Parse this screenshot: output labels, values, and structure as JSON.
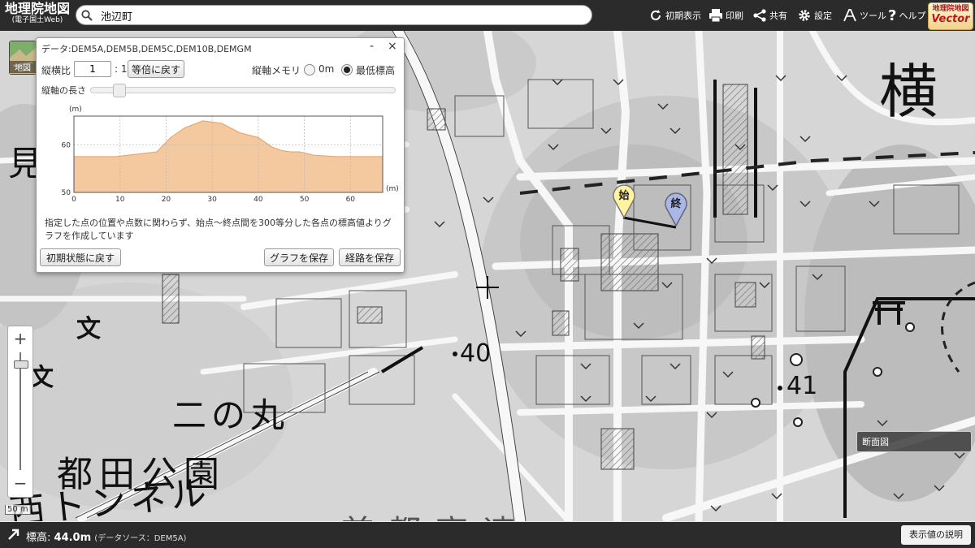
{
  "header": {
    "logo_line1": "地理院地図",
    "logo_line2": "(電子国土Web)",
    "search_value": "池辺町",
    "buttons": {
      "initial_view": "初期表示",
      "print": "印刷",
      "share": "共有",
      "settings": "設定",
      "tools": "ツール",
      "help": "ヘルプ"
    },
    "vector_badge_top": "地理院地図",
    "vector_badge_bottom": "Vector"
  },
  "layer_button": {
    "label": "地図"
  },
  "zoom": {
    "plus": "+",
    "minus": "−",
    "scale": "50 m",
    "level_fraction": 0.93
  },
  "dialog": {
    "title": "データ:DEM5A,DEM5B,DEM5C,DEM10B,DEMGM",
    "minimize": "-",
    "close": "×",
    "aspect_label": "縦横比",
    "aspect_value": "1",
    "aspect_suffix": ": 1",
    "reset_scale_button": "等倍に戻す",
    "vertical_memory_label": "縦軸メモリ",
    "radio_0m": "0m",
    "radio_min": "最低標高",
    "selected_radio": "最低標高",
    "axis_length_label": "縦軸の長さ",
    "note": "指定した点の位置や点数に関わらず、始点～終点間を300等分した各点の標高値よりグラフを作成しています",
    "buttons": {
      "reset": "初期状態に戻す",
      "save_graph": "グラフを保存",
      "save_route": "経路を保存"
    }
  },
  "chart_data": {
    "type": "area",
    "ylabel": "(m)",
    "xlabel": "(m)",
    "xlim": [
      0,
      67
    ],
    "ylim": [
      50,
      66
    ],
    "xticks": [
      0,
      10,
      20,
      30,
      40,
      50,
      60
    ],
    "yticks": [
      50,
      60
    ],
    "fill_color": "#f5c9a0",
    "line_color": "#e8a56a",
    "x": [
      0,
      9,
      18,
      21,
      24,
      28,
      32,
      36,
      40,
      43,
      45,
      47,
      49,
      52,
      57,
      60,
      67
    ],
    "y": [
      57.5,
      57.5,
      58.5,
      61.5,
      63.5,
      65,
      64.5,
      62.5,
      61.5,
      59.5,
      58.8,
      58.5,
      58.5,
      57.8,
      57.5,
      57.5,
      57.5
    ]
  },
  "map_labels": {
    "yoko": "横",
    "ni_no_maru": "二の丸",
    "park": "都田公園",
    "tunnel": "西トンネル",
    "elev40": "40",
    "elev41": "41",
    "highway": "首都高速",
    "school": "文",
    "pin_start": "始",
    "pin_end": "終",
    "left_partial": "見"
  },
  "profile_tag": "断面図",
  "footer": {
    "elev_label": "標高:",
    "elev_value": "44.0m",
    "source": "(データソース：DEM5A)",
    "explain_button": "表示値の説明"
  }
}
